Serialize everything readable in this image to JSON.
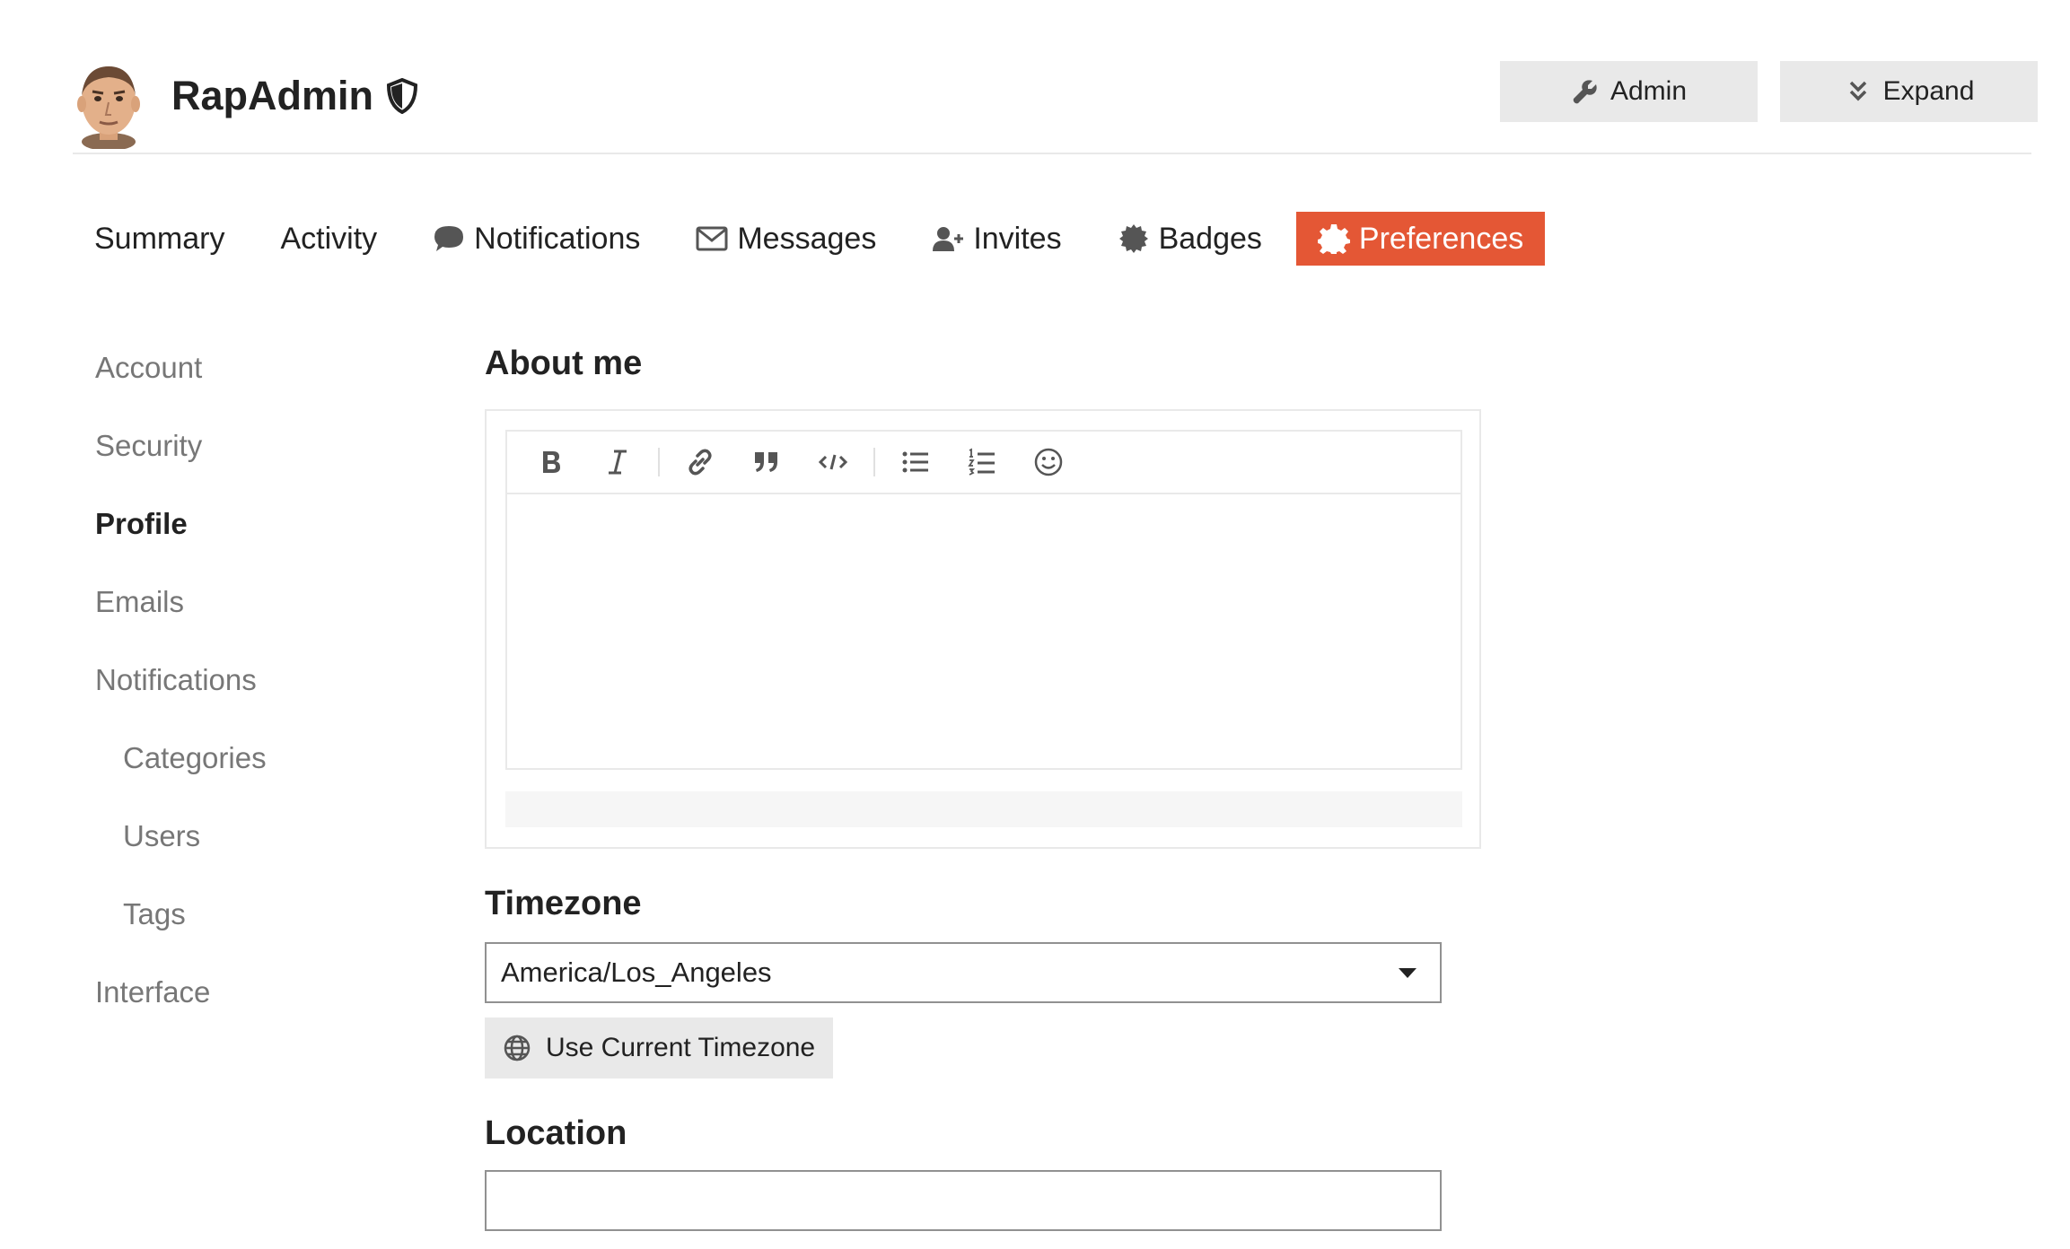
{
  "header": {
    "username": "RapAdmin",
    "admin_button": "Admin",
    "expand_button": "Expand"
  },
  "tabs": [
    {
      "label": "Summary",
      "icon": null
    },
    {
      "label": "Activity",
      "icon": null
    },
    {
      "label": "Notifications",
      "icon": "comment-icon"
    },
    {
      "label": "Messages",
      "icon": "envelope-icon"
    },
    {
      "label": "Invites",
      "icon": "user-plus-icon"
    },
    {
      "label": "Badges",
      "icon": "certificate-icon"
    },
    {
      "label": "Preferences",
      "icon": "gear-icon",
      "active": true
    }
  ],
  "sidebar": {
    "items": [
      {
        "label": "Account"
      },
      {
        "label": "Security"
      },
      {
        "label": "Profile",
        "active": true
      },
      {
        "label": "Emails"
      },
      {
        "label": "Notifications"
      },
      {
        "label": "Categories",
        "sub": true
      },
      {
        "label": "Users",
        "sub": true
      },
      {
        "label": "Tags",
        "sub": true
      },
      {
        "label": "Interface"
      }
    ]
  },
  "about_me": {
    "title": "About me",
    "toolbar": [
      "bold-icon",
      "italic-icon",
      "link-icon",
      "quote-icon",
      "code-icon",
      "bullet-list-icon",
      "numbered-list-icon",
      "emoji-icon"
    ]
  },
  "timezone": {
    "title": "Timezone",
    "value": "America/Los_Angeles",
    "use_current_button": "Use Current Timezone"
  },
  "location": {
    "title": "Location",
    "value": ""
  },
  "colors": {
    "accent": "#e45735",
    "button_bg": "#e9e9e9",
    "muted_text": "#777777"
  }
}
